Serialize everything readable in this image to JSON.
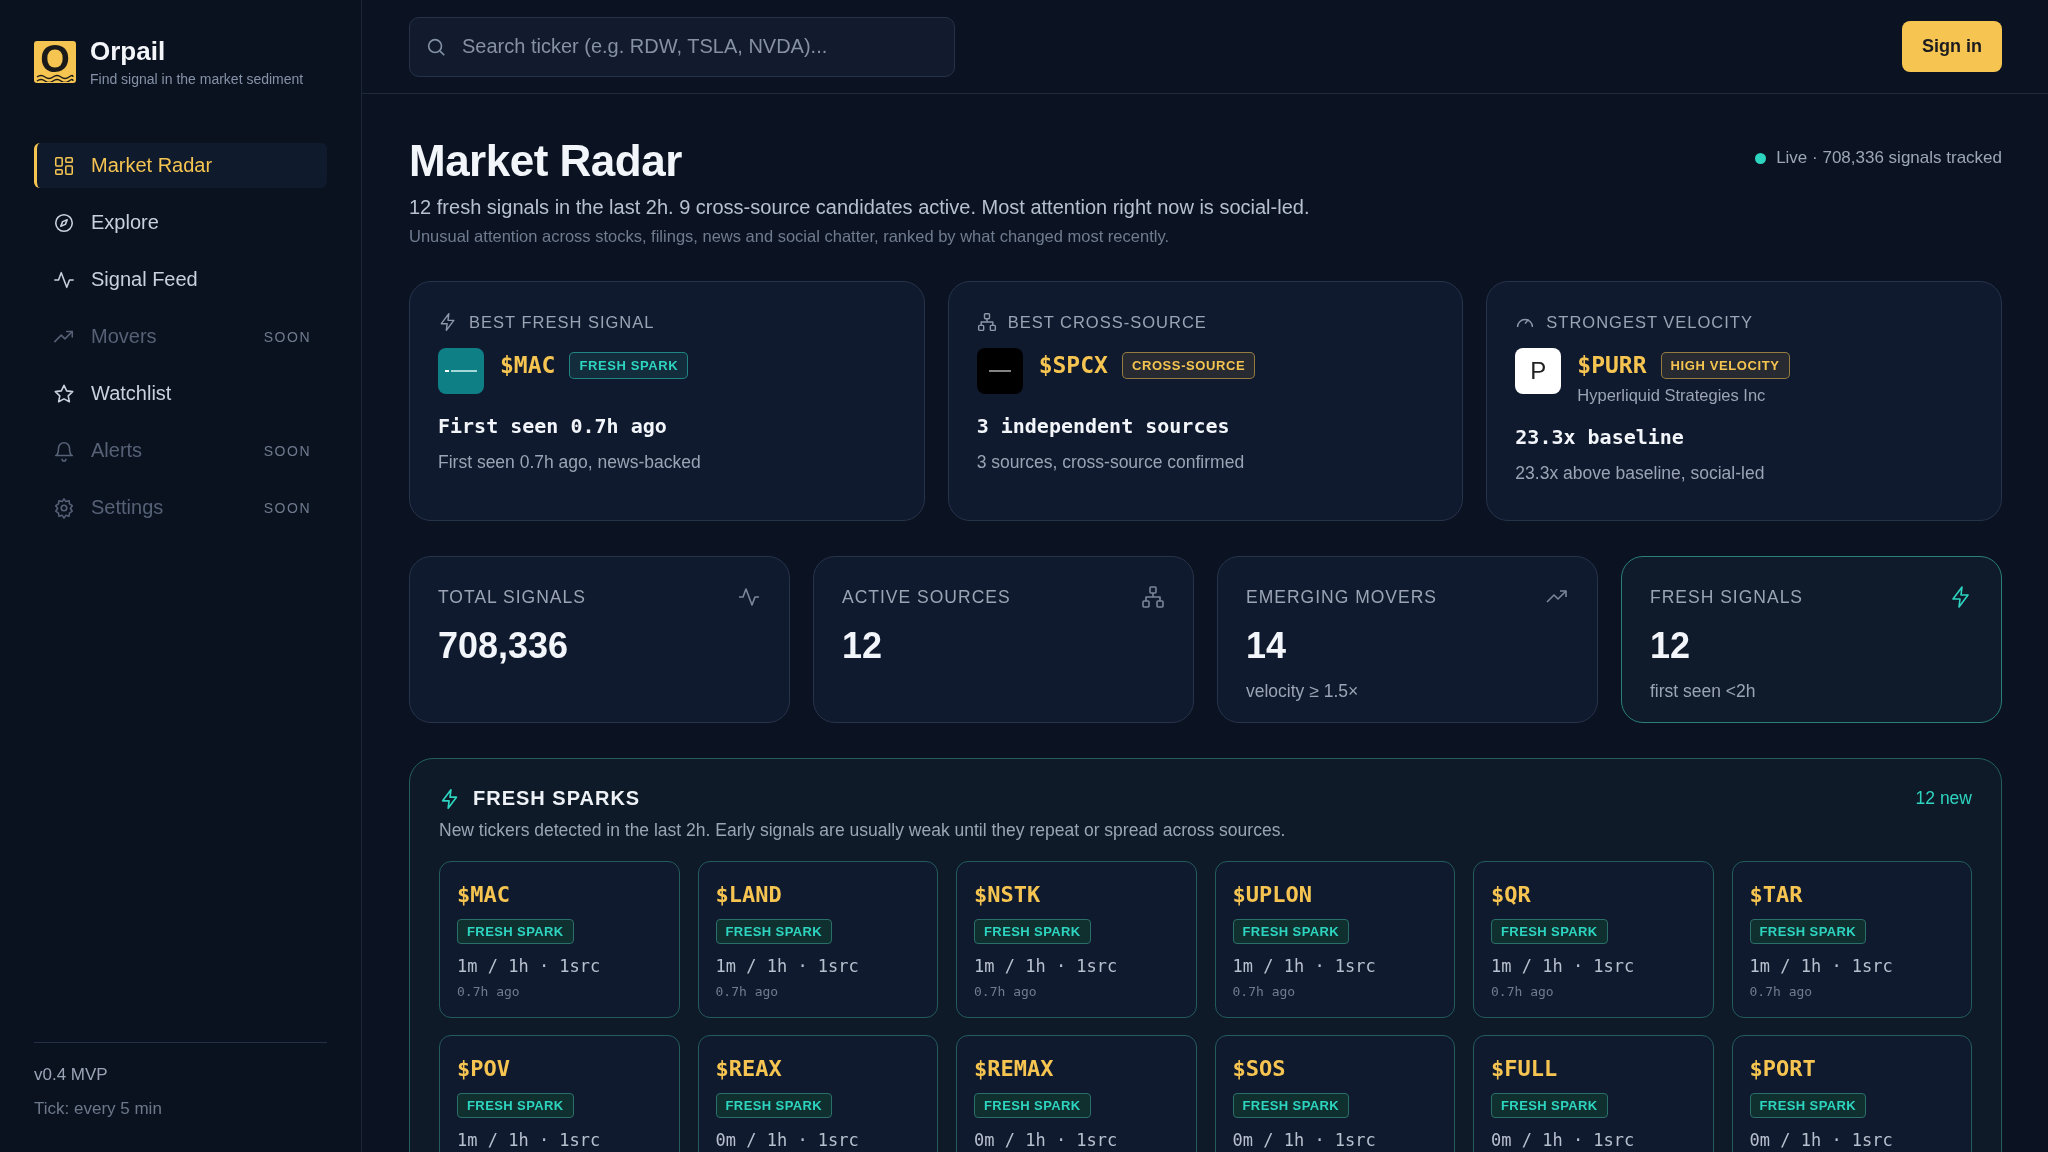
{
  "brand": {
    "logo_letter": "O",
    "name": "Orpail",
    "tagline": "Find signal in the market sediment"
  },
  "nav": [
    {
      "label": "Market Radar",
      "selected": true,
      "disabled": false
    },
    {
      "label": "Explore",
      "selected": false,
      "disabled": false
    },
    {
      "label": "Signal Feed",
      "selected": false,
      "disabled": false
    },
    {
      "label": "Movers",
      "selected": false,
      "disabled": true,
      "badge": "SOON"
    },
    {
      "label": "Watchlist",
      "selected": false,
      "disabled": false
    },
    {
      "label": "Alerts",
      "selected": false,
      "disabled": true,
      "badge": "SOON"
    },
    {
      "label": "Settings",
      "selected": false,
      "disabled": true,
      "badge": "SOON"
    }
  ],
  "sidebar_footer": {
    "version": "v0.4 MVP",
    "tick": "Tick: every 5 min"
  },
  "search": {
    "placeholder": "Search ticker (e.g. RDW, TSLA, NVDA)..."
  },
  "sign_in": "Sign in",
  "header": {
    "title": "Market Radar",
    "summary": "12 fresh signals in the last 2h. 9 cross-source candidates active. Most attention right now is social-led.",
    "description": "Unusual attention across stocks, filings, news and social chatter, ranked by what changed most recently.",
    "live": "Live · 708,336 signals tracked"
  },
  "highlights": [
    {
      "label": "BEST FRESH SIGNAL",
      "logo": {
        "kind": "teal"
      },
      "ticker": "$MAC",
      "badge": "FRESH SPARK",
      "color": "#2dd4bf",
      "headline": "First seen 0.7h ago",
      "detail": "First seen 0.7h ago, news-backed"
    },
    {
      "label": "BEST CROSS-SOURCE",
      "logo": {
        "kind": "dark"
      },
      "ticker": "$SPCX",
      "badge": "CROSS-SOURCE",
      "color": "#f5c451",
      "headline": "3 independent sources",
      "detail": "3 sources, cross-source confirmed"
    },
    {
      "label": "STRONGEST VELOCITY",
      "logo": {
        "kind": "letter",
        "letter": "P"
      },
      "ticker": "$PURR",
      "badge": "HIGH VELOCITY",
      "color": "#f5c451",
      "company": "Hyperliquid Strategies Inc",
      "headline": "23.3x baseline",
      "detail": "23.3x above baseline, social-led"
    }
  ],
  "stats": [
    {
      "label": "TOTAL SIGNALS",
      "value": "708,336",
      "highlighted": false
    },
    {
      "label": "ACTIVE SOURCES",
      "value": "12",
      "highlighted": false
    },
    {
      "label": "EMERGING MOVERS",
      "value": "14",
      "note": "velocity ≥ 1.5×",
      "highlighted": false
    },
    {
      "label": "FRESH SIGNALS",
      "value": "12",
      "note": "first seen <2h",
      "highlighted": true
    }
  ],
  "fresh_sparks": {
    "title": "FRESH SPARKS",
    "count": "12 new",
    "description": "New tickers detected in the last 2h. Early signals are usually weak until they repeat or spread across sources.",
    "items": [
      {
        "ticker": "$MAC",
        "badge": "FRESH SPARK",
        "stats": "1m / 1h · 1src",
        "age": "0.7h ago"
      },
      {
        "ticker": "$LAND",
        "badge": "FRESH SPARK",
        "stats": "1m / 1h · 1src",
        "age": "0.7h ago"
      },
      {
        "ticker": "$NSTK",
        "badge": "FRESH SPARK",
        "stats": "1m / 1h · 1src",
        "age": "0.7h ago"
      },
      {
        "ticker": "$UPLON",
        "badge": "FRESH SPARK",
        "stats": "1m / 1h · 1src",
        "age": "0.7h ago"
      },
      {
        "ticker": "$QR",
        "badge": "FRESH SPARK",
        "stats": "1m / 1h · 1src",
        "age": "0.7h ago"
      },
      {
        "ticker": "$TAR",
        "badge": "FRESH SPARK",
        "stats": "1m / 1h · 1src",
        "age": "0.7h ago"
      },
      {
        "ticker": "$POV",
        "badge": "FRESH SPARK",
        "stats": "1m / 1h · 1src"
      },
      {
        "ticker": "$REAX",
        "badge": "FRESH SPARK",
        "stats": "0m / 1h · 1src"
      },
      {
        "ticker": "$REMAX",
        "badge": "FRESH SPARK",
        "stats": "0m / 1h · 1src"
      },
      {
        "ticker": "$SOS",
        "badge": "FRESH SPARK",
        "stats": "0m / 1h · 1src"
      },
      {
        "ticker": "$FULL",
        "badge": "FRESH SPARK",
        "stats": "0m / 1h · 1src"
      },
      {
        "ticker": "$PORT",
        "badge": "FRESH SPARK",
        "stats": "0m / 1h · 1src"
      }
    ]
  }
}
